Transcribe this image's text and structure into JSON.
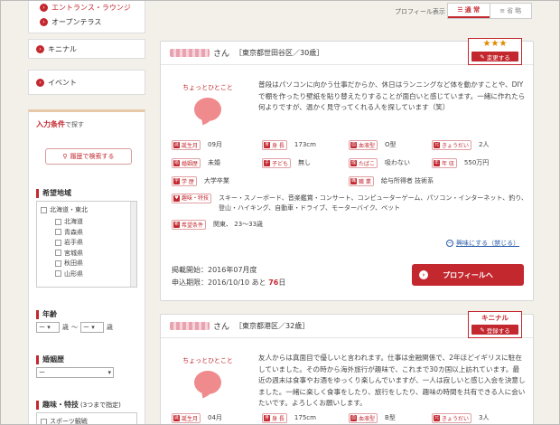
{
  "sidebar": {
    "top_links": [
      "エントランス・ラウンジ",
      "オープンテラス"
    ],
    "links": [
      "キニナル",
      "イベント"
    ],
    "search": {
      "title": "入力条件",
      "title_suffix": "で探す",
      "history_button": "履歴で検索する"
    },
    "region": {
      "title": "希望地域",
      "group": "北海道・東北",
      "items": [
        "北海道",
        "青森県",
        "岩手県",
        "宮城県",
        "秋田県",
        "山形県"
      ]
    },
    "age": {
      "title": "年齢",
      "from_unit": "歳",
      "tilde": "〜",
      "to_unit": "歳",
      "option": "ー"
    },
    "marital": {
      "title": "婚姻歴",
      "option": "ー"
    },
    "hobby": {
      "title": "趣味・特技",
      "note": "(3つまで指定)",
      "first_item": "スポーツ観戦"
    }
  },
  "top": {
    "profile_display": "プロフィール表示",
    "normal": "通 常",
    "compact": "省 略"
  },
  "cards": [
    {
      "name_suffix": "さん",
      "location": "［東京都世田谷区／30歳］",
      "bubble_label": "ちょっとひとこと",
      "intro": "普段はパソコンに向かう仕事だからか、休日はランニングなど体を動かすことや、DIYで棚を作ったり壁紙を貼り替えたりすることが面白いと感じています。一緒に作れたら何よりですが、温かく見守ってくれる人を探しています（笑）",
      "badge_stars": "★★★",
      "badge_button": "変更する",
      "attrs": [
        {
          "icon": "誕",
          "label": "誕生月",
          "value": "09月"
        },
        {
          "icon": "身",
          "label": "身 長",
          "value": "173cm"
        },
        {
          "icon": "血",
          "label": "血液型",
          "value": "O型"
        },
        {
          "icon": "兄",
          "label": "きょうだい",
          "value": "2人"
        },
        {
          "icon": "婚",
          "label": "婚姻歴",
          "value": "未婚"
        },
        {
          "icon": "子",
          "label": "子ども",
          "value": "無し"
        },
        {
          "icon": "煙",
          "label": "たばこ",
          "value": "吸わない"
        },
        {
          "icon": "年",
          "label": "年 収",
          "value": "550万円"
        },
        {
          "icon": "学",
          "label": "学 歴",
          "value": "大学卒業"
        },
        {
          "icon": "職",
          "label": "職 業",
          "value": "給与所得者 技術系"
        }
      ],
      "hobby_label": "趣味・特技",
      "hobby_value": "スキー・スノーボード、音楽鑑賞・コンサート、コンピューターゲーム、パソコン・インターネット、釣り、登山・ハイキング、自動車・ドライブ、モーターバイク、ペット",
      "wish_label": "希望条件",
      "wish_value": "関東、 23～33歳",
      "unfollow": "興味にする（禁じる）",
      "start_label": "掲載開始：",
      "start_value": "2016年07月度",
      "deadline_label": "申込期限：",
      "deadline_value": "2016/10/10 あと",
      "days": "76",
      "days_unit": "日",
      "profile_button": "プロフィールへ"
    },
    {
      "name_suffix": "さん",
      "location": "［東京都港区／32歳］",
      "bubble_label": "ちょっとひとこと",
      "intro": "友人からは真面目で優しいと言われます。仕事は金融関係で、2年ほどイギリスに駐在していました。その時から海外旅行が趣味で、これまで30カ国以上訪れています。最近の週末は食事やお酒をゆっくり楽しんでいますが、一人は寂しいと感じ入会を決意しました。一緒に楽しく食事をしたり、旅行をしたり、趣味の時間を共有できる人に会いたいです。よろしくお願いします。",
      "badge_title": "キニナル",
      "badge_button": "登録する",
      "attrs": [
        {
          "icon": "誕",
          "label": "誕生月",
          "value": "04月"
        },
        {
          "icon": "身",
          "label": "身 長",
          "value": "175cm"
        },
        {
          "icon": "血",
          "label": "血液型",
          "value": "B型"
        },
        {
          "icon": "兄",
          "label": "きょうだい",
          "value": "3人"
        }
      ]
    }
  ],
  "colors": {
    "accent": "#c3282f",
    "bubble": "#ef8b8d",
    "background": "#f3f0ea"
  }
}
